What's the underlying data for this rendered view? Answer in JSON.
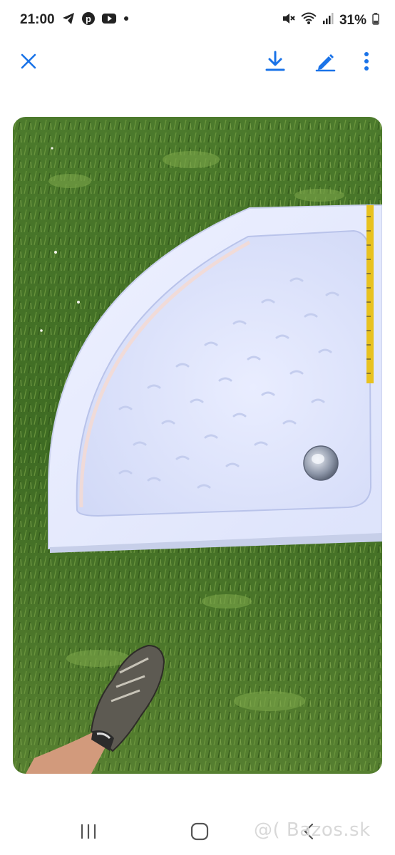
{
  "status_bar": {
    "time": "21:00",
    "battery": "31%",
    "left_icons": [
      "telegram-icon",
      "pinterest-icon",
      "youtube-icon",
      "notification-dot-icon"
    ],
    "right_icons": [
      "mute-icon",
      "wifi-icon",
      "signal-icon",
      "battery-icon"
    ]
  },
  "toolbar": {
    "icons": [
      "close-icon",
      "download-icon",
      "edit-icon",
      "more-icon"
    ],
    "accent": "#1a73e8"
  },
  "photo": {
    "subject": "white quarter-circle shower tray on grass with measuring tape"
  },
  "nav_bar": {
    "icons": [
      "recent-apps-icon",
      "home-icon",
      "back-icon"
    ]
  },
  "watermark": {
    "text": "@( Bazos.sk"
  }
}
